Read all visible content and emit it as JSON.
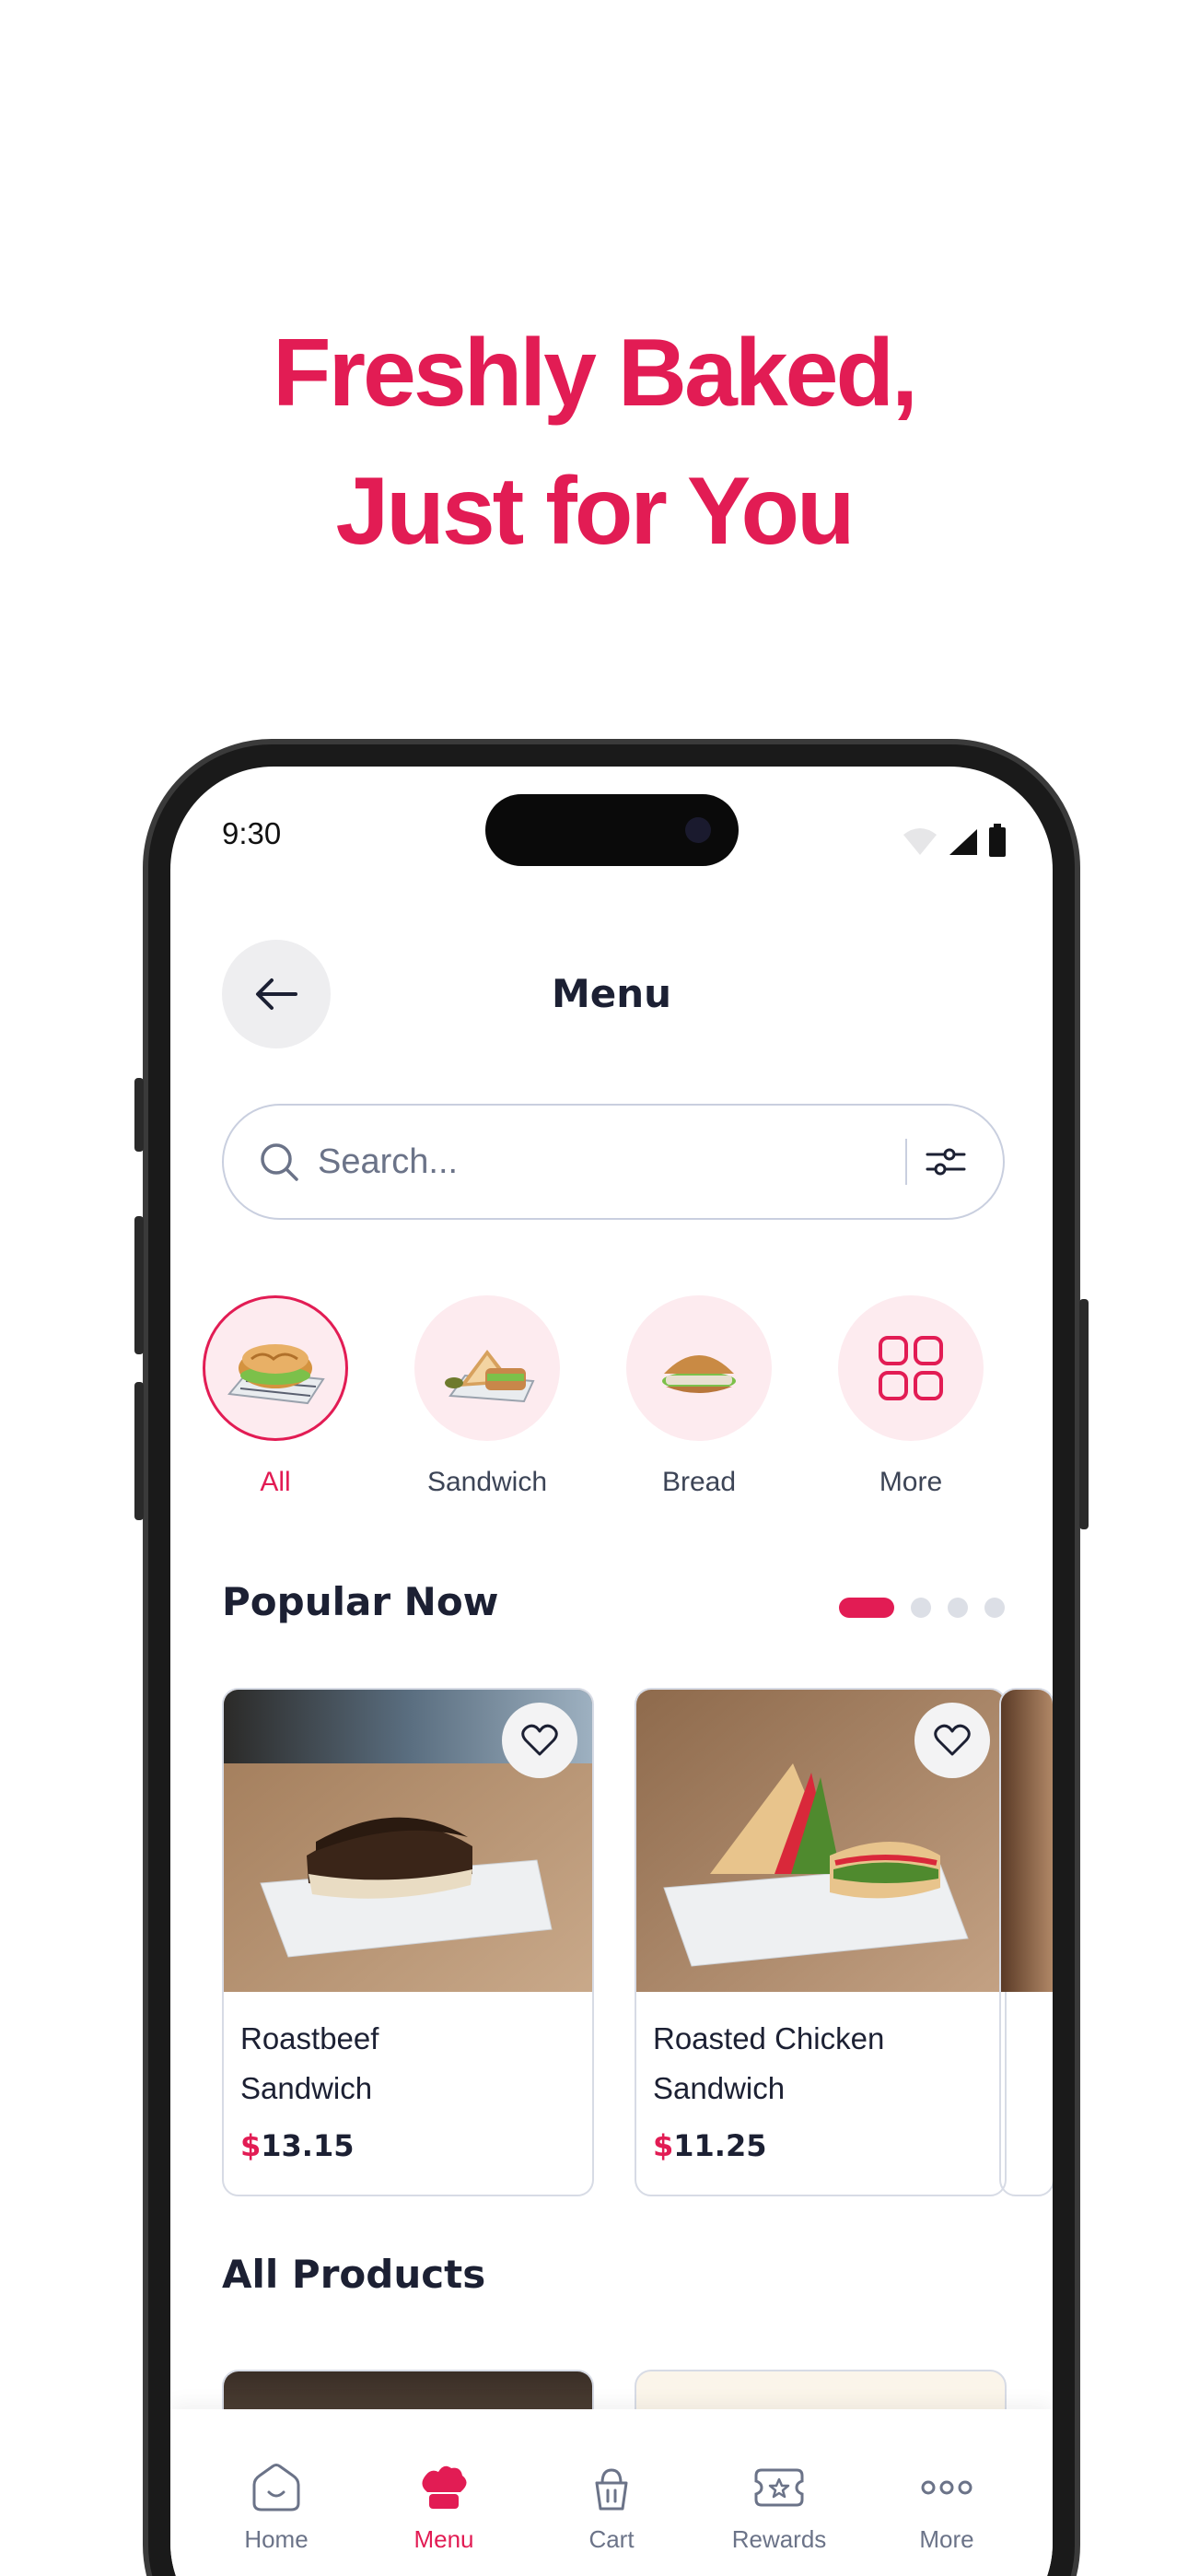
{
  "promo": {
    "line1": "Freshly Baked,",
    "line2": "Just for You"
  },
  "status_bar": {
    "time": "9:30"
  },
  "header": {
    "title": "Menu"
  },
  "search": {
    "placeholder": "Search..."
  },
  "categories": [
    {
      "label": "All",
      "active": true
    },
    {
      "label": "Sandwich",
      "active": false
    },
    {
      "label": "Bread",
      "active": false
    },
    {
      "label": "More",
      "active": false
    }
  ],
  "popular": {
    "title": "Popular Now",
    "page_dots": {
      "count": 4,
      "active": 1
    },
    "items": [
      {
        "name_line1": "Roastbeef",
        "name_line2": "Sandwich",
        "currency": "$",
        "price": "13.15"
      },
      {
        "name_line1": "Roasted Chicken",
        "name_line2": "Sandwich",
        "currency": "$",
        "price": "11.25"
      }
    ]
  },
  "all_products": {
    "title": "All Products"
  },
  "tabbar": {
    "items": [
      {
        "label": "Home",
        "icon": "home-icon",
        "active": false
      },
      {
        "label": "Menu",
        "icon": "chef-hat-icon",
        "active": true
      },
      {
        "label": "Cart",
        "icon": "cart-icon",
        "active": false
      },
      {
        "label": "Rewards",
        "icon": "ticket-icon",
        "active": false
      },
      {
        "label": "More",
        "icon": "more-dots-icon",
        "active": false
      }
    ]
  },
  "colors": {
    "accent": "#e21c54",
    "accent_soft": "#fdebef",
    "text": "#1c2033",
    "muted": "#6b7388"
  }
}
